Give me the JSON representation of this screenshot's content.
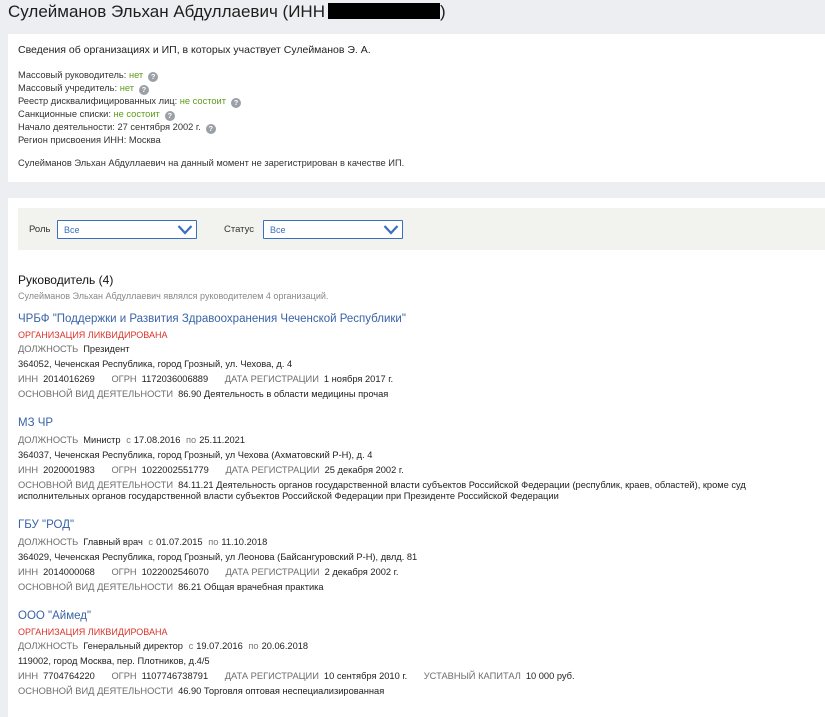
{
  "header": {
    "title": "Сулейманов Эльхан Абдуллаевич (ИНН",
    "title_close": ")"
  },
  "info": {
    "heading": "Сведения об организациях и ИП, в которых участвует Сулейманов Э. А.",
    "mass_director_label": "Массовый руководитель:",
    "mass_director_value": "нет",
    "mass_founder_label": "Массовый учредитель:",
    "mass_founder_value": "нет",
    "disq_label": "Реестр дисквалифицированных лиц:",
    "disq_value": "не состоит",
    "sanctions_label": "Санкционные списки:",
    "sanctions_value": "не состоит",
    "start_label": "Начало деятельности:",
    "start_value": "27 сентября 2002 г.",
    "region_label": "Регион присвоения ИНН:",
    "region_value": "Москва",
    "ip_note": "Сулейманов Эльхан Абдуллаевич на данный момент не зарегистрирован в качестве ИП.",
    "help_glyph": "?"
  },
  "filters": {
    "role_label": "Роль",
    "role_value": "Все",
    "status_label": "Статус",
    "status_value": "Все"
  },
  "section": {
    "title": "Руководитель (4)",
    "subtitle": "Сулейманов Эльхан Абдуллаевич являлся руководителем 4 организаций."
  },
  "labels": {
    "position": "ДОЛЖНОСТЬ",
    "inn": "ИНН",
    "ogrn": "ОГРН",
    "reg_date": "ДАТА РЕГИСТРАЦИИ",
    "activity": "ОСНОВНОЙ ВИД ДЕЯТЕЛЬНОСТИ",
    "capital": "УСТАВНЫЙ КАПИТАЛ",
    "from": "с",
    "to": "по"
  },
  "orgs": [
    {
      "name": "ЧРБФ \"Поддержки и Развития Здравоохранения Чеченской Республики\"",
      "status": "ОРГАНИЗАЦИЯ ЛИКВИДИРОВАНА",
      "position": "Президент",
      "address": "364052, Чеченская Республика, город Грозный, ул. Чехова, д. 4",
      "inn": "2014016269",
      "ogrn": "1172036006889",
      "reg_date": "1 ноября 2017 г.",
      "activity": "86.90 Деятельность в области медицины прочая"
    },
    {
      "name": "МЗ ЧР",
      "position": "Министр",
      "from": "17.08.2016",
      "to": "25.11.2021",
      "address": "364037, Чеченская Республика, город Грозный, ул Чехова (Ахматовский Р-Н), д. 4",
      "inn": "2020001983",
      "ogrn": "1022002551779",
      "reg_date": "25 декабря 2002 г.",
      "activity": "84.11.21 Деятельность органов государственной власти субъектов Российской Федерации (республик, краев, областей), кроме суд",
      "activity_cont": "исполнительных органов государственной власти субъектов Российской Федерации при Президенте Российской Федерации"
    },
    {
      "name": "ГБУ \"РОД\"",
      "position": "Главный врач",
      "from": "01.07.2015",
      "to": "11.10.2018",
      "address": "364029, Чеченская Республика, город Грозный, ул Леонова (Байсангуровский Р-Н), двлд. 81",
      "inn": "2014000068",
      "ogrn": "1022002546070",
      "reg_date": "2 декабря 2002 г.",
      "activity": "86.21 Общая врачебная практика"
    },
    {
      "name": "ООО \"Аймед\"",
      "status": "ОРГАНИЗАЦИЯ ЛИКВИДИРОВАНА",
      "position": "Генеральный директор",
      "from": "19.07.2016",
      "to": "20.06.2018",
      "address": "119002, город Москва, пер. Плотников, д.4/5",
      "inn": "7704764220",
      "ogrn": "1107746738791",
      "reg_date": "10 сентября 2010 г.",
      "capital": "10 000 руб.",
      "activity": "46.90 Торговля оптовая неспециализированная"
    }
  ]
}
